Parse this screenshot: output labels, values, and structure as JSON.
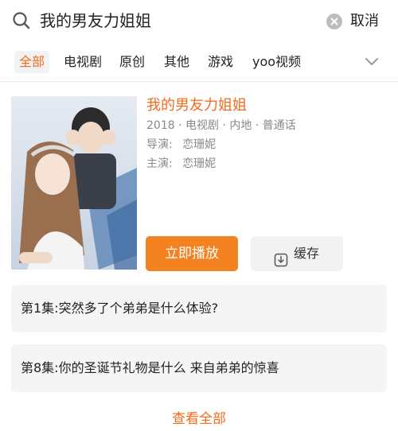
{
  "search": {
    "query": "我的男友力姐姐",
    "cancel_label": "取消"
  },
  "tabs": [
    {
      "label": "全部",
      "active": true
    },
    {
      "label": "电视剧",
      "active": false
    },
    {
      "label": "原创",
      "active": false
    },
    {
      "label": "其他",
      "active": false
    },
    {
      "label": "游戏",
      "active": false
    },
    {
      "label": "yoo视频",
      "active": false
    }
  ],
  "result": {
    "title": "我的男友力姐姐",
    "meta": "2018 · 电视剧 · 内地 · 普通话",
    "director_label": "导演:",
    "director": "恋珊妮",
    "cast_label": "主演:",
    "cast": "恋珊妮",
    "play_label": "立即播放",
    "cache_label": "缓存"
  },
  "episodes": [
    {
      "text": "第1集:突然多了个弟弟是什么体验?"
    },
    {
      "text": "第8集:你的圣诞节礼物是什么 来自弟弟的惊喜"
    }
  ],
  "view_all_label": "查看全部",
  "colors": {
    "accent": "#f26b1d",
    "play_button": "#f58220",
    "muted_text": "#888888"
  }
}
